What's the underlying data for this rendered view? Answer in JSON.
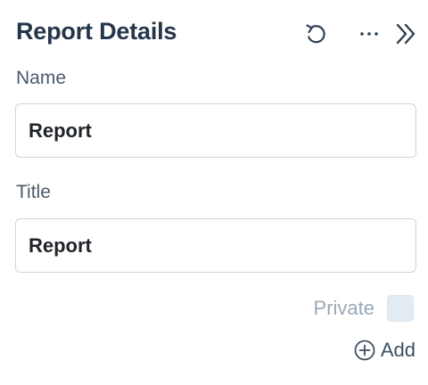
{
  "panel": {
    "title": "Report Details",
    "icons": {
      "reset": "reset-icon",
      "more": "more-horizontal-icon",
      "collapse": "double-chevron-right-icon"
    }
  },
  "fields": {
    "name": {
      "label": "Name",
      "value": "Report"
    },
    "title": {
      "label": "Title",
      "value": "Report"
    }
  },
  "private": {
    "label": "Private",
    "checked": false
  },
  "add": {
    "label": "Add",
    "icon": "plus-circle-icon"
  }
}
